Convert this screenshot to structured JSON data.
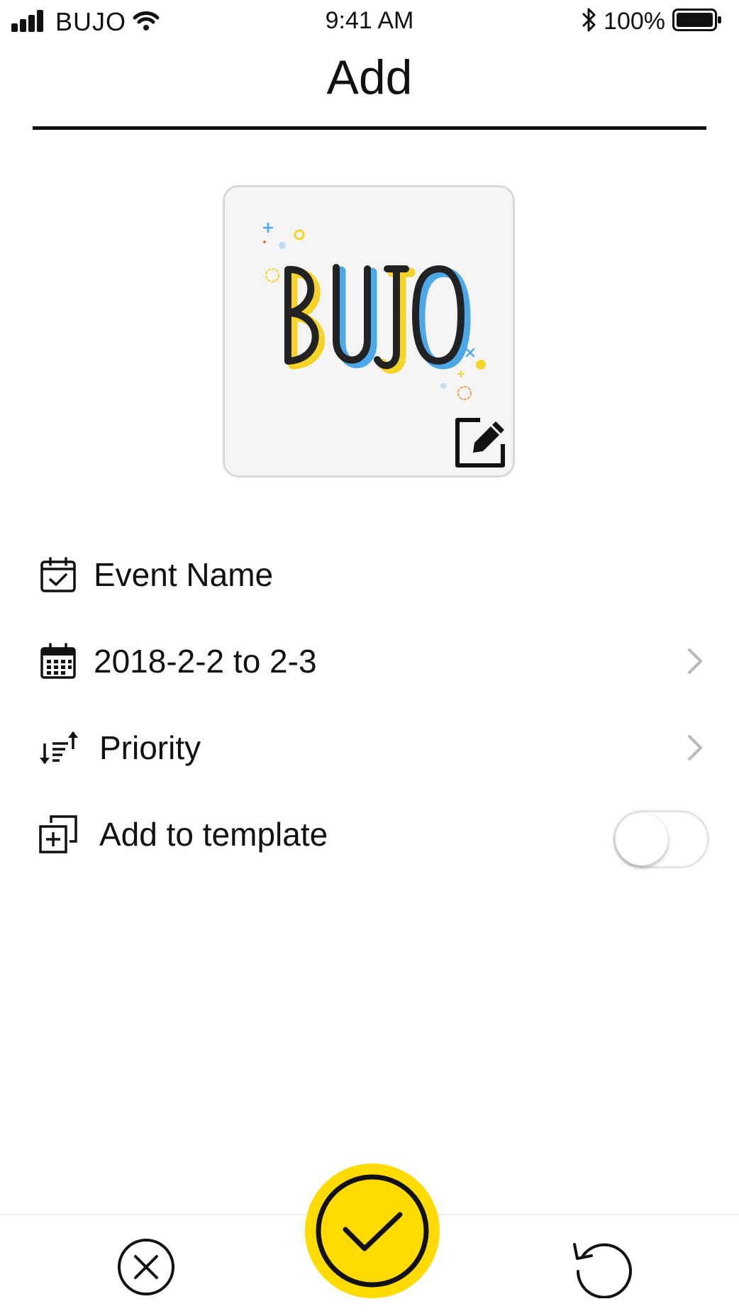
{
  "status_bar": {
    "carrier": "BUJO",
    "time": "9:41 AM",
    "battery": "100%",
    "icons": [
      "signal-icon",
      "wifi-icon",
      "bluetooth-icon",
      "battery-icon"
    ]
  },
  "header": {
    "title": "Add"
  },
  "cover": {
    "logo_text": "BUJO",
    "icons": [
      "bujo-logo",
      "edit-icon"
    ]
  },
  "form": {
    "event_name": {
      "placeholder": "Event Name",
      "value": "",
      "icon": "calendar-check-icon"
    },
    "date_range": {
      "label": "2018-2-2 to 2-3",
      "icon": "calendar-grid-icon"
    },
    "priority": {
      "label": "Priority",
      "icon": "sort-icon"
    },
    "template": {
      "label": "Add to template",
      "icon": "add-copy-icon",
      "enabled": false
    }
  },
  "toolbar": {
    "icons": [
      "close-circle-icon",
      "check-icon",
      "reset-icon"
    ]
  },
  "colors": {
    "accent": "#FFDB00",
    "logo_yellow": "#F5D327",
    "logo_blue": "#4DA8E8",
    "text": "#111111",
    "chevron": "#b8b8b8"
  }
}
